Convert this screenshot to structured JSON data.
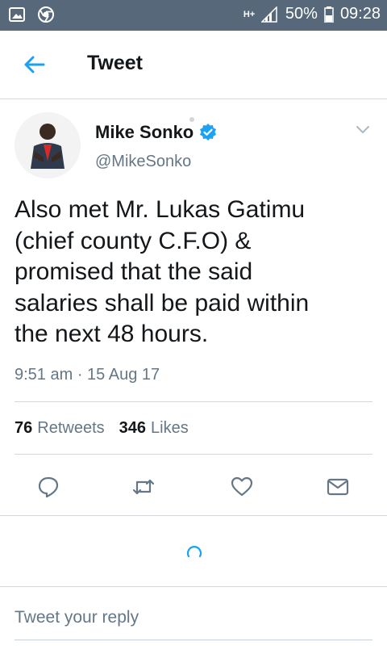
{
  "status_bar": {
    "network": "H+",
    "battery": "50%",
    "time": "09:28"
  },
  "header": {
    "title": "Tweet"
  },
  "tweet": {
    "author_name": "Mike Sonko",
    "handle": "@MikeSonko",
    "text": "Also met Mr. Lukas Gatimu\n(chief  county C.F.O) &\npromised that the said\nsalaries shall be paid within\nthe next 48 hours.",
    "timestamp": "9:51 am · 15 Aug 17",
    "retweets_count": "76",
    "retweets_label": "Retweets",
    "likes_count": "346",
    "likes_label": "Likes"
  },
  "reply": {
    "placeholder": "Tweet your reply"
  },
  "colors": {
    "status_bar": "#56687a",
    "accent": "#1da1f2",
    "secondary_text": "#657786",
    "border": "#d4d8dc"
  }
}
